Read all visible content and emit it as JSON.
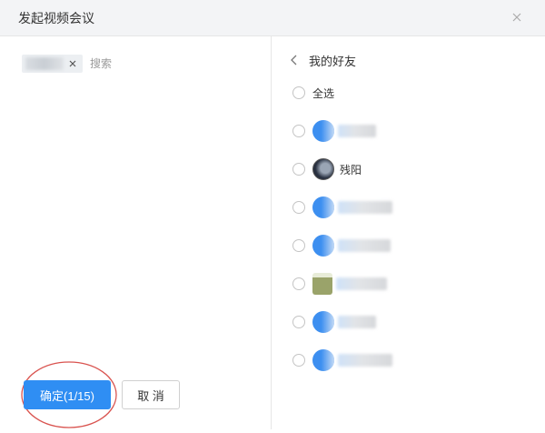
{
  "dialog": {
    "title": "发起视频会议",
    "close_icon": "close-icon"
  },
  "left_pane": {
    "selected_chip_remove_icon": "close-x-icon",
    "search_placeholder": "搜索",
    "confirm_label": "确定(1/15)",
    "cancel_label": "取 消"
  },
  "right_pane": {
    "header_title": "我的好友",
    "back_icon": "chevron-left-icon",
    "select_all_label": "全选",
    "friends": [
      {
        "name": "",
        "avatar": "blue"
      },
      {
        "name": "残阳",
        "avatar": "dark"
      },
      {
        "name": "",
        "avatar": "blue"
      },
      {
        "name": "",
        "avatar": "blue"
      },
      {
        "name": "",
        "avatar": "square-image"
      },
      {
        "name": "",
        "avatar": "blue"
      },
      {
        "name": "",
        "avatar": "blue"
      }
    ]
  },
  "colors": {
    "primary": "#2f8ef3",
    "annotation": "#d9534f",
    "titlebar_bg": "#f3f4f6",
    "divider": "#e6e6e6"
  }
}
